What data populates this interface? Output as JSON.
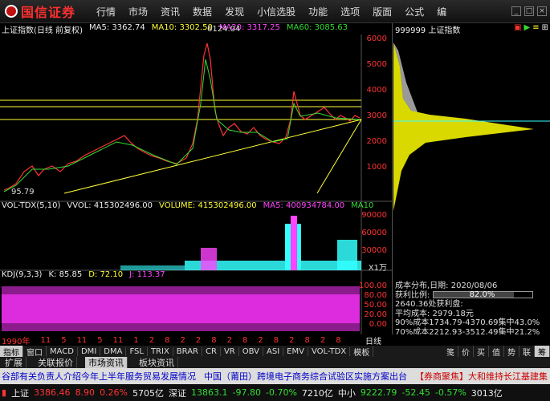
{
  "app": {
    "logo_text": "国信证券",
    "brand_color": "#ff3030"
  },
  "menu": [
    "行情",
    "市场",
    "资讯",
    "数据",
    "发现",
    "小信选股",
    "功能",
    "选项",
    "版面",
    "公式",
    "编"
  ],
  "main_header": {
    "title": "上证指数(日线 前复权)",
    "ma5": "MA5: 3362.74",
    "ma10": "MA10: 3302.50",
    "ma20": "MA20: 3317.25",
    "ma60": "MA60: 3085.63"
  },
  "price_axis": [
    "6000",
    "5000",
    "4000",
    "3000",
    "2000",
    "1000"
  ],
  "peak_label": "6124.04",
  "low_label": "95.79",
  "vol_header": {
    "title": "VOL-TDX(5,10)",
    "vvol": "VVOL: 415302496.00",
    "volume": "VOLUME: 415302496.00",
    "ma5": "MA5: 400934784.00",
    "ma10": "MA10"
  },
  "vol_axis": [
    "90000",
    "60000",
    "30000"
  ],
  "vol_unit": "X1万",
  "kdj_header": {
    "title": "KDJ(9,3,3)",
    "k": "K: 85.85",
    "d": "D: 72.10",
    "j": "J: 113.37"
  },
  "kdj_axis": [
    "100.00",
    "80.00",
    "50.00",
    "20.00",
    "0.00"
  ],
  "x_axis": [
    "1990年",
    "11",
    "5",
    "11",
    "5",
    "11",
    "1",
    "2",
    "8",
    "2",
    "2",
    "8",
    "2",
    "8",
    "2",
    "8",
    "2",
    "8",
    "2",
    "8"
  ],
  "period_label": "日线",
  "side_header": {
    "code": "999999 上证指数"
  },
  "side_axis": [],
  "side_info": {
    "title": "成本分布,日期: 2020/08/06",
    "profit_label": "获利比例:",
    "profit_value": "82.0%",
    "profit_ratio": 0.82,
    "profit_plate": "2640.36处获利盘:",
    "avg_cost": "平均成本: 2979.18元",
    "c90": "90%成本1734.79-4370.69集中43.0%",
    "c70": "70%成本2212.93-3512.49集中21.2%"
  },
  "tabs_row1": [
    "指标",
    "窗口",
    "MACD",
    "DMI",
    "DMA",
    "FSL",
    "TRIX",
    "BRAR",
    "CR",
    "VR",
    "OBV",
    "ASI",
    "EMV",
    "VOL-TDX",
    "模板"
  ],
  "tabs_row2": [
    "扩展",
    "关联报价",
    "市场资讯",
    "板块资讯"
  ],
  "side_tabs": [
    "笺",
    "价",
    "买",
    "值",
    "势",
    "联",
    "筹"
  ],
  "news": {
    "row1": [
      "谷部有关负责人介绍今年上半年服务贸易发展情况",
      "中国（莆田）跨境电子商务综合试验区实施方案出台",
      "【券商聚焦】大和维持长江基建集"
    ]
  },
  "status": {
    "sh_name": "上证",
    "sh_price": "3386.46",
    "sh_change": "8.90",
    "sh_pct": "0.26%",
    "sh_vol": "5705亿",
    "sz_name": "深证",
    "sz_price": "13863.1",
    "sz_change": "-97.80",
    "sz_pct": "-0.70%",
    "sz_vol": "7210亿",
    "zx_name": "中小",
    "zx_price": "9222.79",
    "zx_change": "-52.45",
    "zx_pct": "-0.57%",
    "zx_vol": "3013亿"
  }
}
